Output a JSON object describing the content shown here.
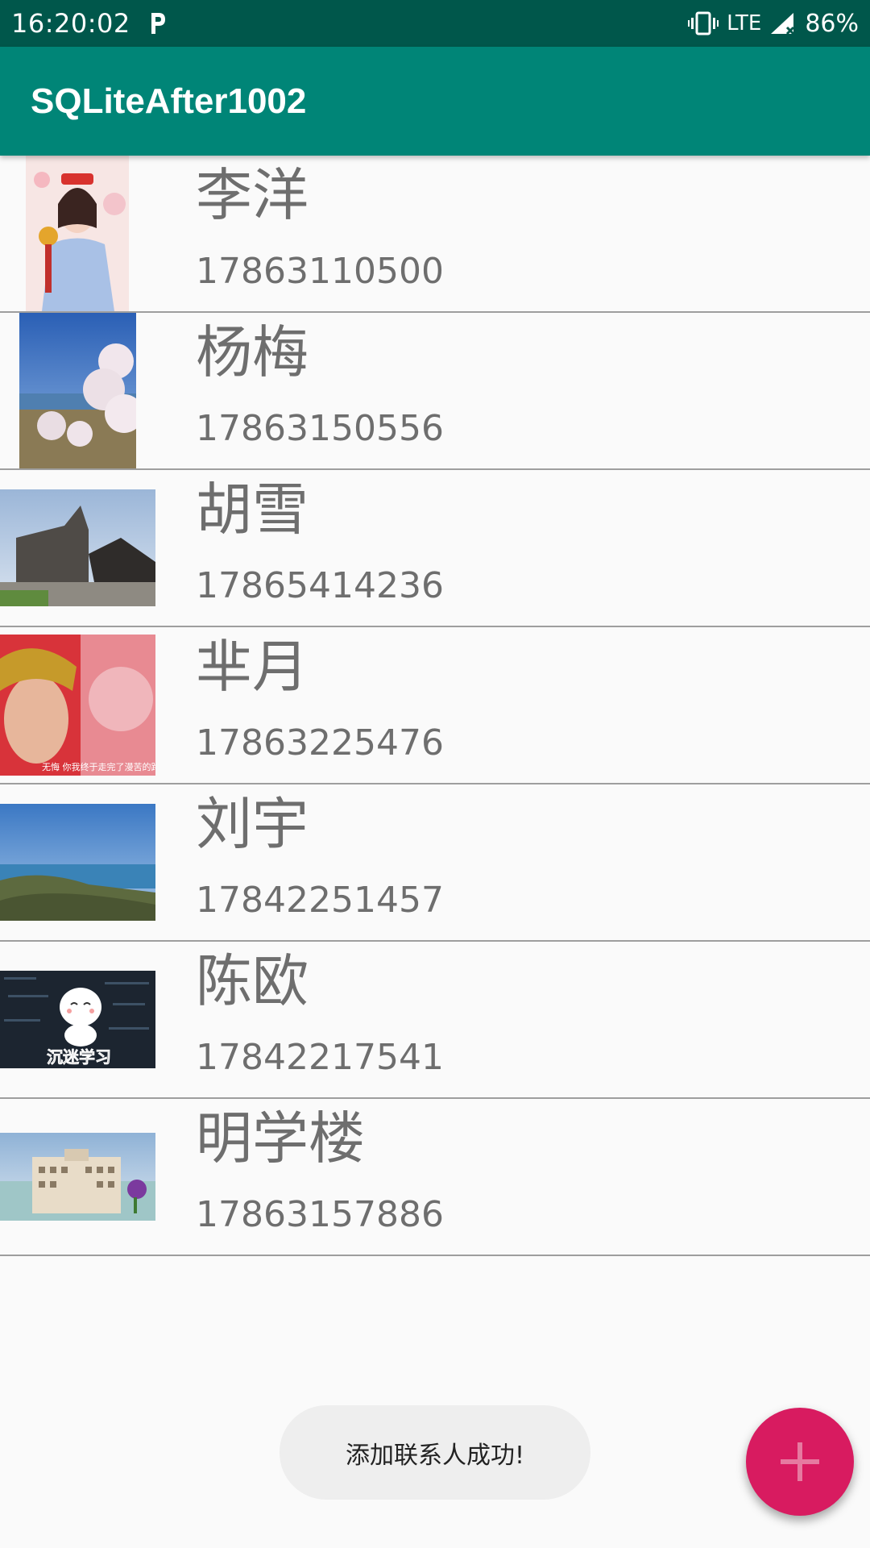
{
  "status_bar": {
    "time": "16:20:02",
    "network": "LTE",
    "battery": "86%"
  },
  "app_bar": {
    "title": "SQLiteAfter1002"
  },
  "contacts": [
    {
      "name": "李洋",
      "phone": "17863110500",
      "photo": "contact-photo-girl-costume"
    },
    {
      "name": "杨梅",
      "phone": "17863150556",
      "photo": "contact-photo-blossom-sea"
    },
    {
      "name": "胡雪",
      "phone": "17865414236",
      "photo": "contact-photo-memorial-building"
    },
    {
      "name": "芈月",
      "phone": "17863225476",
      "photo": "contact-photo-drama-still"
    },
    {
      "name": "刘宇",
      "phone": "17842251457",
      "photo": "contact-photo-coast"
    },
    {
      "name": "陈欧",
      "phone": "17842217541",
      "photo": "contact-photo-cartoon"
    },
    {
      "name": "明学楼",
      "phone": "17863157886",
      "photo": "contact-photo-building"
    }
  ],
  "photo_texts": {
    "cartoon": "沉迷学习",
    "drama_caption": "无悔 你我终于走完了漫苦的路"
  },
  "toast": {
    "message": "添加联系人成功!"
  },
  "fab": {
    "icon": "plus-icon",
    "color": "#d81b60"
  },
  "colors": {
    "status_bar": "#00574b",
    "app_bar": "#008577",
    "accent": "#d81b60"
  }
}
